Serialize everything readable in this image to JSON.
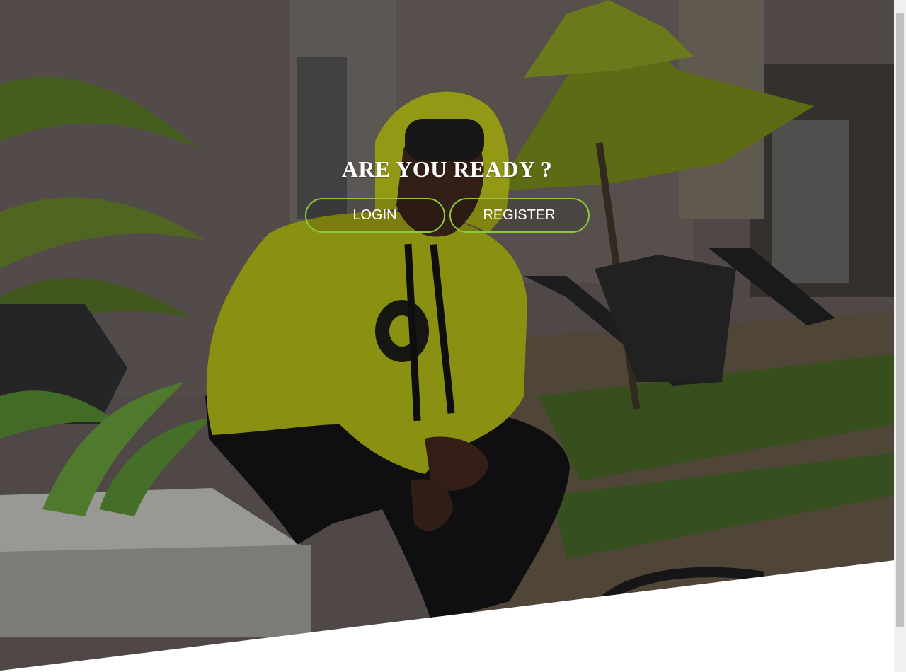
{
  "hero": {
    "image_alt": "Man in yellow hoodie sitting by a pool area with umbrella and lounge chairs",
    "heading": "ARE YOU READY ?",
    "buttons": {
      "login_label": "LOGIN",
      "register_label": "REGISTER"
    }
  },
  "colors": {
    "button_border": "#8dc63f",
    "heading_text": "#ffffff",
    "page_background": "#ffffff"
  }
}
